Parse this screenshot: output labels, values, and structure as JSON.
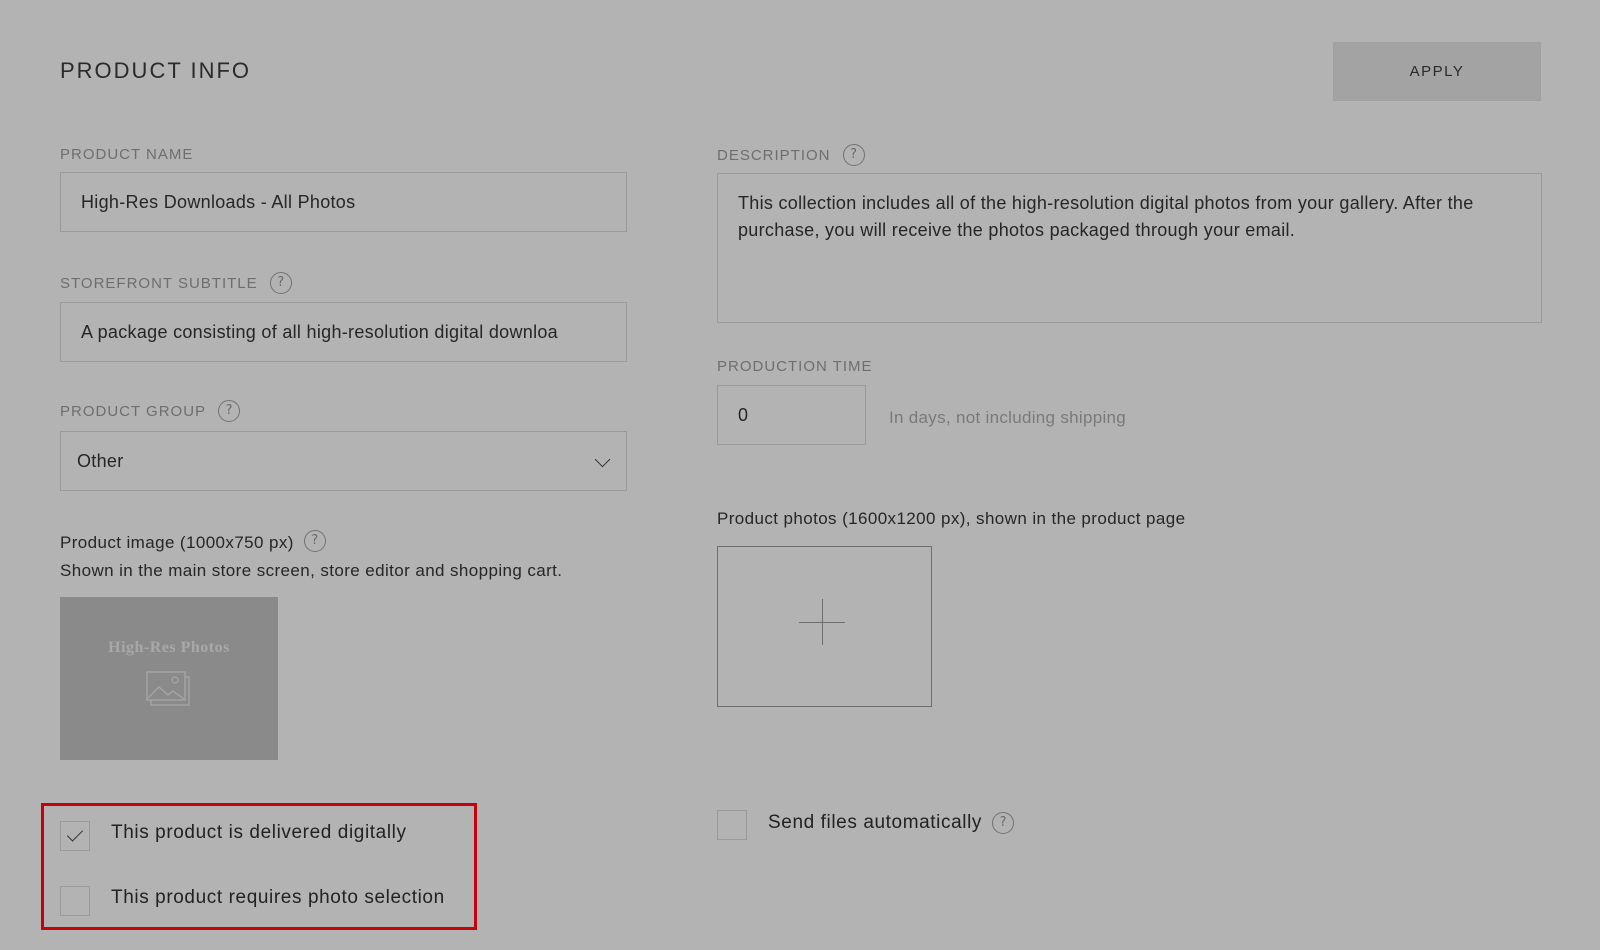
{
  "header": {
    "title": "PRODUCT INFO",
    "apply_label": "APPLY"
  },
  "product_name": {
    "label": "PRODUCT NAME",
    "value": "High-Res Downloads - All Photos"
  },
  "storefront_subtitle": {
    "label": "STOREFRONT SUBTITLE",
    "value": "A package consisting of all high-resolution digital downloa"
  },
  "product_group": {
    "label": "PRODUCT GROUP",
    "value": "Other"
  },
  "product_image": {
    "label": "Product image (1000x750 px)",
    "note": "Shown in the main store screen, store editor and shopping cart.",
    "thumbnail_text": "High-Res Photos"
  },
  "description": {
    "label": "DESCRIPTION",
    "value": "This collection includes all of the high-resolution digital photos from your gallery. After the purchase, you will receive the photos packaged through your email."
  },
  "production_time": {
    "label": "PRODUCTION TIME",
    "value": "0",
    "hint": "In days, not including shipping"
  },
  "product_photos": {
    "label": "Product photos (1600x1200 px), shown in the product page"
  },
  "options": {
    "delivered_digitally": {
      "label": "This product is delivered digitally",
      "checked": true
    },
    "requires_photo_selection": {
      "label": "This product requires photo selection",
      "checked": false
    },
    "send_files_automatically": {
      "label": "Send files automatically",
      "checked": false
    }
  },
  "icons": {
    "help": "?",
    "help_name": "help-icon",
    "chevron": "chevron-down-icon",
    "plus": "plus-icon",
    "image": "image-icon",
    "check": "check-icon"
  },
  "colors": {
    "background": "#b3b3b3",
    "button": "#a3a3a3",
    "highlight": "#c8000b",
    "thumbnail": "#8a8a8a"
  }
}
